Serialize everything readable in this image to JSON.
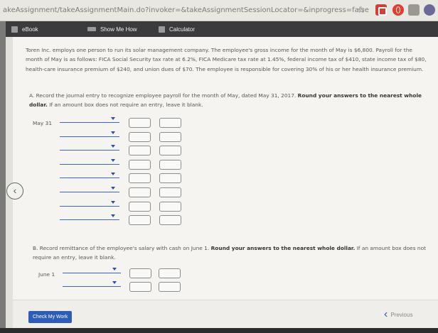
{
  "browser": {
    "url": "akeAssignment/takeAssignmentMain.do?invoker=&takeAssignmentSessionLocator=&inprogress=false"
  },
  "toolbar": {
    "ebook_label": "eBook",
    "show_me_how_label": "Show Me How",
    "calculator_label": "Calculator"
  },
  "problem": {
    "intro": "Toren Inc. employs one person to run its solar management company. The employee's gross income for the month of May is $6,800. Payroll for the month of May is as follows: FICA Social Security tax rate at 6.2%, FICA Medicare tax rate at 1.45%, federal income tax of $410, state income tax of $80, health-care insurance premium of $240, and union dues of $70. The employee is responsible for covering 30% of his or her health insurance premium."
  },
  "part_a": {
    "text_start": "A. Record the journal entry to recognize employee payroll for the month of May, dated May 31, 2017.",
    "bold_text": "Round your answers to the nearest whole dollar.",
    "text_end": "If an amount box does not require an entry, leave it blank.",
    "date_label": "May 31"
  },
  "part_b": {
    "text_start": "B. Record remittance of the employee's salary with cash on June 1.",
    "bold_text": "Round your answers to the nearest whole dollar.",
    "text_end": "If an amount box does not require an entry, leave it blank.",
    "date_label": "June 1"
  },
  "footer": {
    "check_my_work_label": "Check My Work",
    "previous_label": "Previous"
  }
}
